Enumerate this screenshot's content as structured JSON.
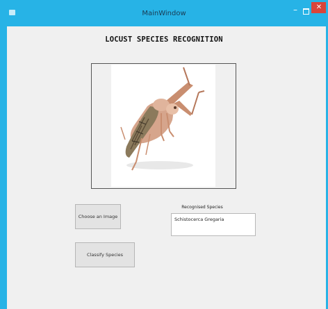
{
  "window": {
    "title": "MainWindow",
    "controls": {
      "minimize": "–",
      "close": "✕"
    }
  },
  "main": {
    "heading": "LOCUST SPECIES RECOGNITION",
    "image": {
      "subject": "locust"
    },
    "buttons": {
      "choose_image": "Choose an Image",
      "classify": "Classify Species"
    },
    "result": {
      "label": "Recognised Species",
      "value": "Schistocerca Gregaria"
    }
  },
  "colors": {
    "frame": "#27b3e6",
    "close": "#d9443a",
    "background": "#f0f0f0"
  }
}
